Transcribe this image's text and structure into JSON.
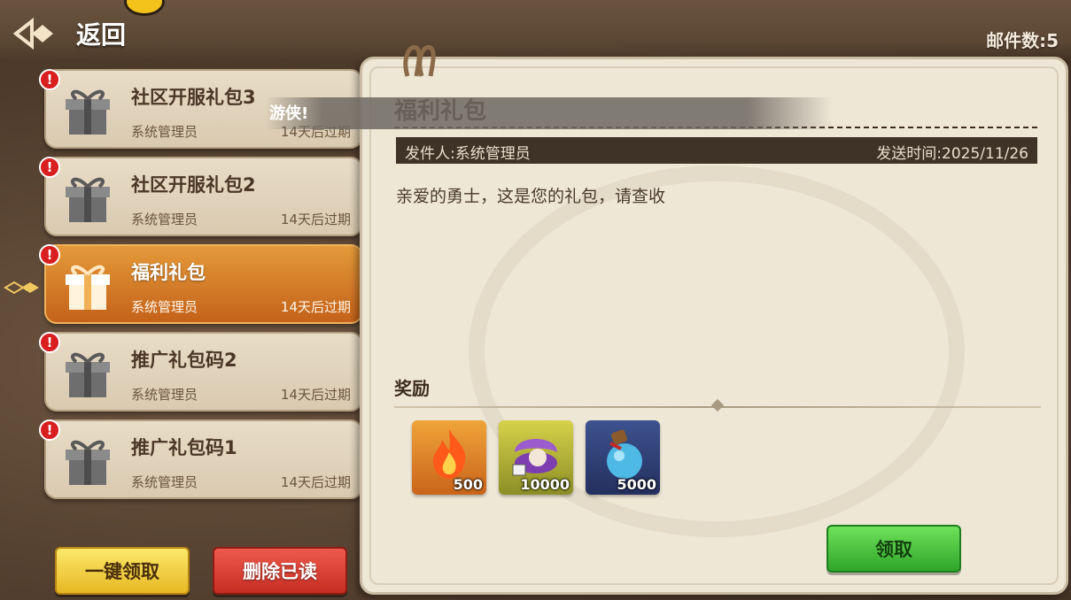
{
  "header": {
    "back_label": "返回",
    "mail_count": "邮件数:5"
  },
  "mail_list": [
    {
      "title": "社区开服礼包3",
      "sender": "系统管理员",
      "expire": "14天后过期",
      "unread": true,
      "active": false
    },
    {
      "title": "社区开服礼包2",
      "sender": "系统管理员",
      "expire": "14天后过期",
      "unread": true,
      "active": false
    },
    {
      "title": "福利礼包",
      "sender": "系统管理员",
      "expire": "14天后过期",
      "unread": true,
      "active": true
    },
    {
      "title": "推广礼包码2",
      "sender": "系统管理员",
      "expire": "14天后过期",
      "unread": true,
      "active": false
    },
    {
      "title": "推广礼包码1",
      "sender": "系统管理员",
      "expire": "14天后过期",
      "unread": true,
      "active": false
    }
  ],
  "toast": {
    "text": "游侠!"
  },
  "actions": {
    "claim_all": "一键领取",
    "delete_read": "删除已读"
  },
  "detail": {
    "title": "福利礼包",
    "sender": "发件人:系统管理员",
    "sent_time": "发送时间:2025/11/26",
    "body": "亲爱的勇士，这是您的礼包，请查收",
    "reward_label": "奖励",
    "rewards": [
      {
        "icon": "flame-icon",
        "qty": "500",
        "bg": "#e08a22"
      },
      {
        "icon": "pearl-shell-icon",
        "qty": "10000",
        "bg": "#b6b83a"
      },
      {
        "icon": "potion-icon",
        "qty": "5000",
        "bg": "#2f3f7a"
      }
    ],
    "claim_label": "领取"
  },
  "colors": {
    "accent_orange": "#d7832c",
    "claim_green": "#3fbf35",
    "alert_red": "#d81e1e"
  }
}
